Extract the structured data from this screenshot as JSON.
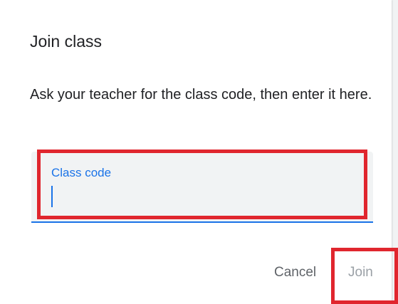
{
  "dialog": {
    "title": "Join class",
    "description": "Ask your teacher for the class code, then enter it here.",
    "field": {
      "label": "Class code",
      "value": ""
    },
    "buttons": {
      "cancel_label": "Cancel",
      "join_label": "Join"
    }
  },
  "colors": {
    "accent": "#1a73e8",
    "highlight": "#e0262e",
    "field_background": "#f1f3f4",
    "text": "#202124",
    "disabled_text": "#9aa0a6"
  }
}
